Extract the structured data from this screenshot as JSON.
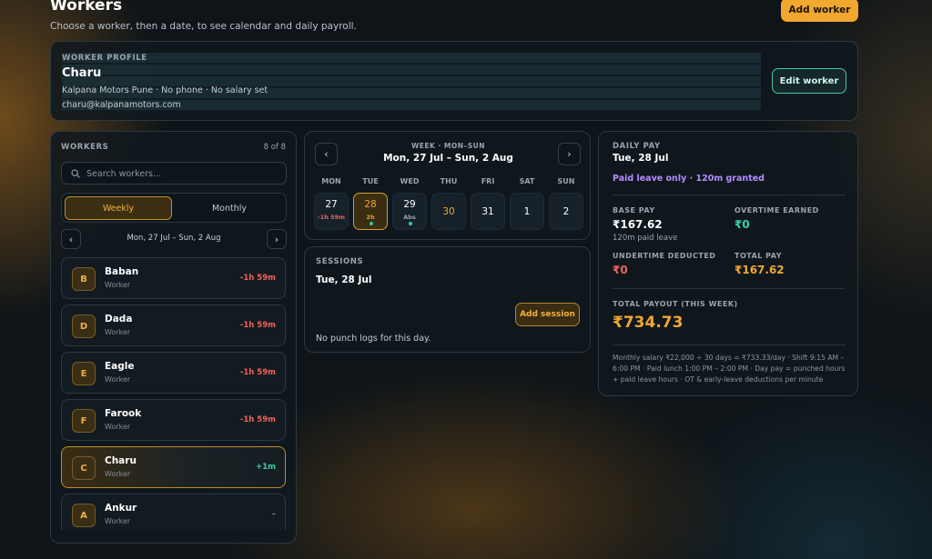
{
  "header": {
    "title": "Workers",
    "subtitle": "Choose a worker, then a date, to see calendar and daily payroll.",
    "add_worker_label": "Add worker"
  },
  "profile": {
    "eyebrow": "WORKER PROFILE",
    "name": "Charu",
    "meta": "Kalpana Motors Pune · No phone · No salary set",
    "email": "charu@kalpanamotors.com",
    "edit_label": "Edit worker"
  },
  "workers": {
    "title": "WORKERS",
    "count": "8 of 8",
    "search_placeholder": "Search workers...",
    "toggle": {
      "weekly": "Weekly",
      "monthly": "Monthly",
      "active": "weekly"
    },
    "range_label": "Mon, 27 Jul – Sun, 2 Aug",
    "prev_glyph": "‹",
    "next_glyph": "›",
    "items": [
      {
        "initial": "B",
        "name": "Baban",
        "role": "Worker",
        "delta": "-1h 59m",
        "tone": "neg"
      },
      {
        "initial": "D",
        "name": "Dada",
        "role": "Worker",
        "delta": "-1h 59m",
        "tone": "neg"
      },
      {
        "initial": "E",
        "name": "Eagle",
        "role": "Worker",
        "delta": "-1h 59m",
        "tone": "neg"
      },
      {
        "initial": "F",
        "name": "Farook",
        "role": "Worker",
        "delta": "-1h 59m",
        "tone": "neg"
      },
      {
        "initial": "C",
        "name": "Charu",
        "role": "Worker",
        "delta": "+1m",
        "tone": "pos",
        "selected": true
      },
      {
        "initial": "A",
        "name": "Ankur",
        "role": "Worker",
        "delta": "–",
        "tone": "neutral"
      }
    ]
  },
  "calendar": {
    "eyebrow": "WEEK · MON–SUN",
    "range": "Mon, 27 Jul – Sun, 2 Aug",
    "prev_glyph": "‹",
    "next_glyph": "›",
    "weekdays": [
      "MON",
      "TUE",
      "WED",
      "THU",
      "FRI",
      "SAT",
      "SUN"
    ],
    "days": [
      {
        "num": "27",
        "note": "-1h 59m",
        "note_tone": "neg"
      },
      {
        "num": "28",
        "note": "2h",
        "note_tone": "amber",
        "dot": true,
        "selected": true
      },
      {
        "num": "29",
        "note": "Abs",
        "note_tone": "muted",
        "dot": true
      },
      {
        "num": "30",
        "today": true
      },
      {
        "num": "31"
      },
      {
        "num": "1"
      },
      {
        "num": "2"
      }
    ]
  },
  "sessions": {
    "eyebrow": "SESSIONS",
    "date": "Tue, 28 Jul",
    "add_label": "Add session",
    "empty": "No punch logs for this day."
  },
  "daily_pay": {
    "eyebrow": "DAILY PAY",
    "date": "Tue, 28 Jul",
    "leave_note": "Paid leave only · 120m granted",
    "base_label": "BASE PAY",
    "base_value": "₹167.62",
    "base_sub": "120m paid leave",
    "ot_label": "OVERTIME EARNED",
    "ot_value": "₹0",
    "ut_label": "UNDERTIME DEDUCTED",
    "ut_value": "₹0",
    "total_label": "TOTAL PAY",
    "total_value": "₹167.62",
    "payout_label": "TOTAL PAYOUT (THIS WEEK)",
    "payout_value": "₹734.73",
    "note": "Monthly salary ₹22,000 ÷ 30 days = ₹733.33/day · Shift 9:15 AM – 6:00 PM · Paid lunch 1:00 PM – 2:00 PM · Day pay = punched hours + paid leave hours · OT & early-leave deductions per minute"
  },
  "colors": {
    "accent": "#f2a72f",
    "positive": "#39d3a8",
    "negative": "#f0645a",
    "leave": "#b58cff"
  }
}
